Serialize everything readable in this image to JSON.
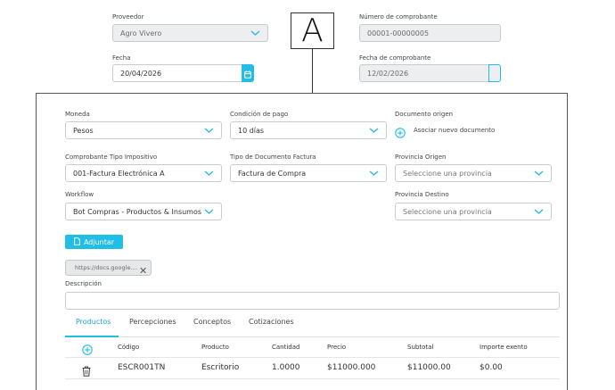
{
  "top_form": {
    "proveedor": {
      "label": "Proveedor",
      "value": "Agro Vivero"
    },
    "numero_comprobante": {
      "label": "Número de comprobante",
      "value": "00001-00000005"
    },
    "fecha": {
      "label": "Fecha",
      "value": "20/04/2026"
    },
    "fecha_comprobante": {
      "label": "Fecha de comprobante",
      "value": "12/02/2026"
    }
  },
  "annotation_tag": "A",
  "form": {
    "moneda": {
      "label": "Moneda",
      "value": "Pesos"
    },
    "condicion_pago": {
      "label": "Condición de pago",
      "value": "10 días"
    },
    "documento_origen": {
      "label": "Documento origen",
      "action": "Asociar nuevo documento"
    },
    "comprobante_tipo": {
      "label": "Comprobante Tipo Impositivo",
      "value": "001-Factura Electrónica A"
    },
    "tipo_documento": {
      "label": "Tipo de Documento Factura",
      "value": "Factura de Compra"
    },
    "provincia_origen": {
      "label": "Provincia Origen",
      "placeholder": "Seleccione una provincia"
    },
    "workflow": {
      "label": "Workflow",
      "value": "Bot Compras - Productos & Insumos"
    },
    "provincia_destino": {
      "label": "Provincia Destino",
      "placeholder": "Seleccione una provincia"
    },
    "adjuntar_label": "Adjuntar",
    "attachment_chip": "https://docs.google....",
    "descripcion": {
      "label": "Descripción",
      "value": ""
    }
  },
  "tabs": [
    {
      "label": "Productos",
      "active": true
    },
    {
      "label": "Percepciones",
      "active": false
    },
    {
      "label": "Conceptos",
      "active": false
    },
    {
      "label": "Cotizaciones",
      "active": false
    }
  ],
  "table": {
    "headers": [
      "Código",
      "Producto",
      "Cantidad",
      "Precio",
      "Subtotal",
      "Importe exento"
    ],
    "rows": [
      {
        "codigo": "ESCR001TN",
        "producto": "Escritorio",
        "cantidad": "1.0000",
        "precio": "$11000.000",
        "subtotal": "$11000.00",
        "importe_exento": "$0.00"
      }
    ]
  },
  "colors": {
    "accent": "#20bde6",
    "active_tab": "#1d9fd0",
    "field_border": "#c8ccd0",
    "disabled_bg": "#eceef0"
  },
  "icons": [
    "chevron-down-icon",
    "calendar-icon",
    "add-circle-icon",
    "file-icon",
    "close-icon",
    "trash-icon"
  ]
}
